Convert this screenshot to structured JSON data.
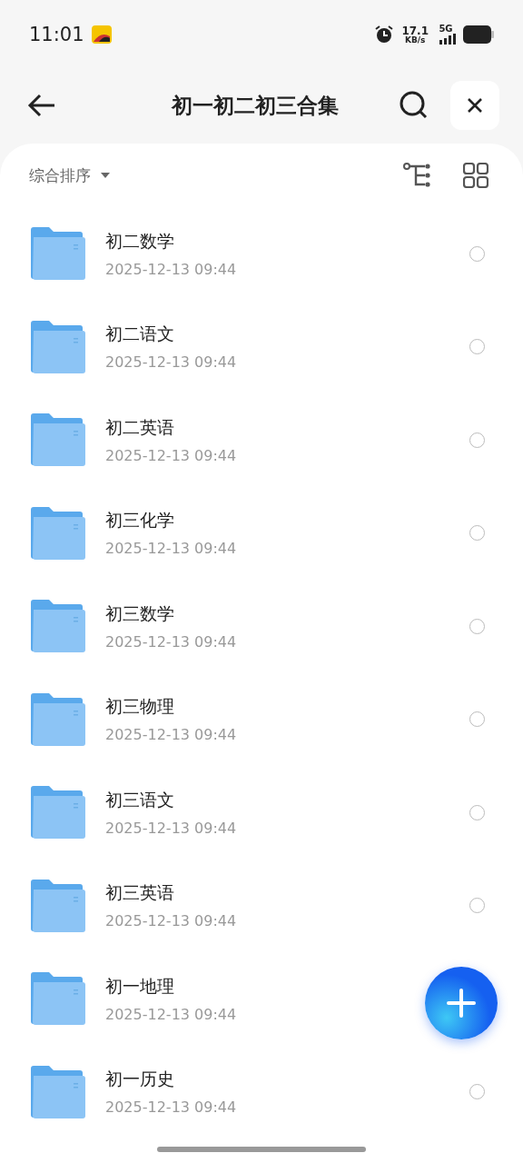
{
  "status_bar": {
    "time": "11:01",
    "speed": "17.1",
    "speed_unit": "KB/s",
    "network": "5G"
  },
  "header": {
    "title": "初一初二初三合集"
  },
  "toolbar": {
    "sort": "综合排序"
  },
  "folders": [
    {
      "name": "初二数学",
      "date": "2025-12-13 09:44",
      "selected": false
    },
    {
      "name": "初二语文",
      "date": "2025-12-13 09:44",
      "selected": false
    },
    {
      "name": "初二英语",
      "date": "2025-12-13 09:44",
      "selected": false
    },
    {
      "name": "初三化学",
      "date": "2025-12-13 09:44",
      "selected": false
    },
    {
      "name": "初三数学",
      "date": "2025-12-13 09:44",
      "selected": false
    },
    {
      "name": "初三物理",
      "date": "2025-12-13 09:44",
      "selected": false
    },
    {
      "name": "初三语文",
      "date": "2025-12-13 09:44",
      "selected": false
    },
    {
      "name": "初三英语",
      "date": "2025-12-13 09:44",
      "selected": false
    },
    {
      "name": "初一地理",
      "date": "2025-12-13 09:44"
    },
    {
      "name": "初一历史",
      "date": "2025-12-13 09:44",
      "selected": false
    }
  ]
}
